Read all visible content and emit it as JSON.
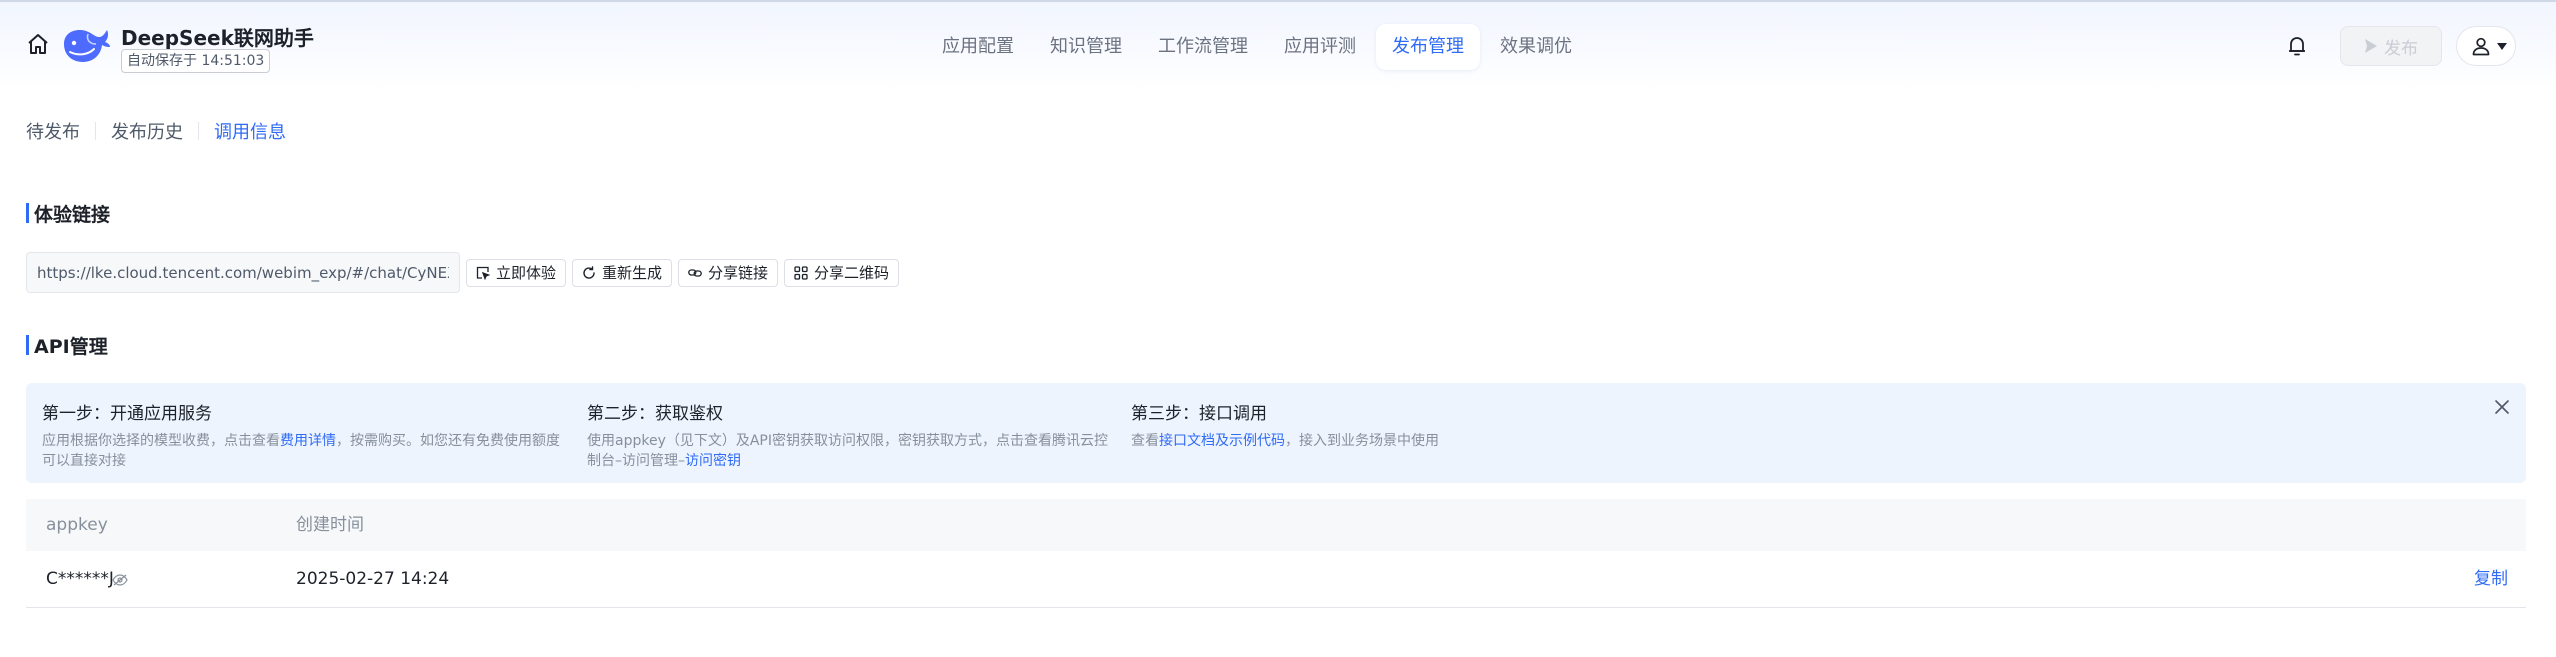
{
  "header": {
    "app_title": "DeepSeek联网助手",
    "autosave": "自动保存于 14:51:03",
    "publish_label": "发布"
  },
  "nav": {
    "tabs": [
      {
        "label": "应用配置"
      },
      {
        "label": "知识管理"
      },
      {
        "label": "工作流管理"
      },
      {
        "label": "应用评测"
      },
      {
        "label": "发布管理",
        "active": true
      },
      {
        "label": "效果调优"
      }
    ]
  },
  "subtabs": [
    {
      "label": "待发布"
    },
    {
      "label": "发布历史"
    },
    {
      "label": "调用信息",
      "active": true
    }
  ],
  "experience": {
    "title": "体验链接",
    "url": "https://lke.cloud.tencent.com/webim_exp/#/chat/CyNEXw",
    "buttons": [
      {
        "label": "立即体验",
        "icon": "open-cursor-icon"
      },
      {
        "label": "重新生成",
        "icon": "refresh-icon"
      },
      {
        "label": "分享链接",
        "icon": "link-icon"
      },
      {
        "label": "分享二维码",
        "icon": "qrcode-icon"
      }
    ]
  },
  "api": {
    "title": "API管理",
    "steps": [
      {
        "title": "第一步：开通应用服务",
        "desc_before": "应用根据你选择的模型收费，点击查看",
        "link": "费用详情",
        "desc_after": "，按需购买。如您还有免费使用额度可以直接对接"
      },
      {
        "title": "第二步：获取鉴权",
        "desc_before": "使用appkey（见下文）及API密钥获取访问权限，密钥获取方式，点击查看腾讯云控制台–访问管理–",
        "link": "访问密钥",
        "desc_after": ""
      },
      {
        "title": "第三步：接口调用",
        "desc_before": "查看",
        "link": "接口文档及示例代码",
        "desc_after": "，接入到业务场景中使用"
      }
    ],
    "table": {
      "columns": [
        "appkey",
        "创建时间"
      ],
      "rows": [
        {
          "appkey": "C******J",
          "created": "2025-02-27 14:24",
          "action": "复制"
        }
      ]
    }
  },
  "colors": {
    "accent": "#2f6bf6",
    "panel_bg": "#eef4fe"
  }
}
